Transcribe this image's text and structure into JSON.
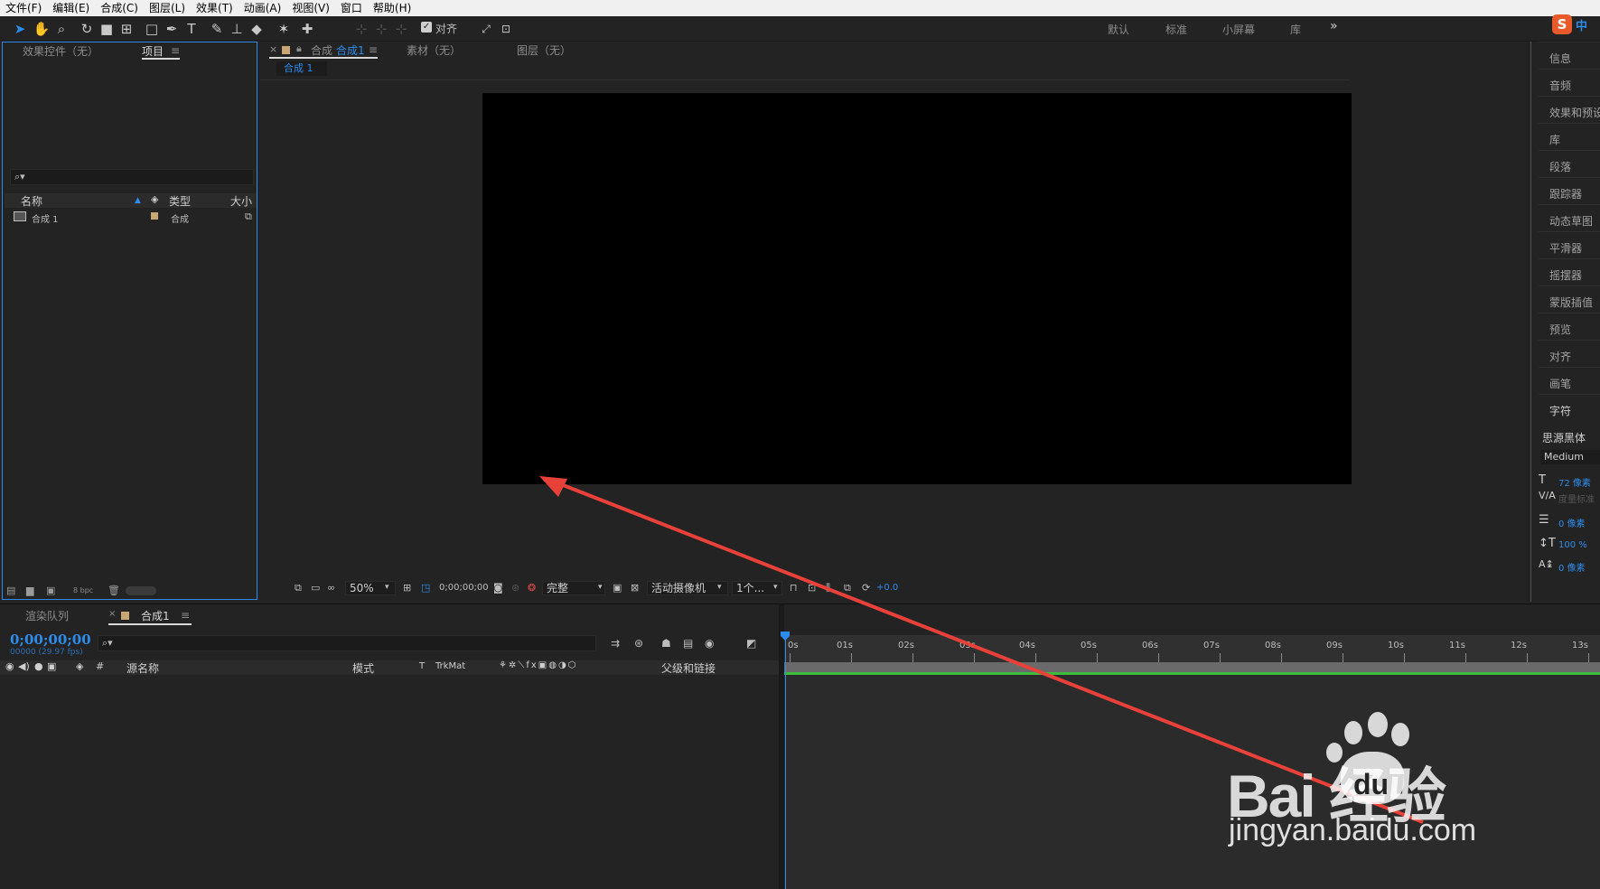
{
  "menubar": [
    "文件(F)",
    "编辑(E)",
    "合成(C)",
    "图层(L)",
    "效果(T)",
    "动画(A)",
    "视图(V)",
    "窗口",
    "帮助(H)"
  ],
  "toolbar": {
    "align_label": "对齐",
    "workspaces": [
      "默认",
      "标准",
      "小屏幕",
      "库"
    ],
    "more": "»"
  },
  "project_panel": {
    "tab_effects": "效果控件（无）",
    "tab_project": "项目",
    "menu_icon": "≡",
    "columns": {
      "name": "名称",
      "type": "类型",
      "size": "大小"
    },
    "items": [
      {
        "name": "合成 1",
        "type": "合成"
      }
    ],
    "bpc": "8 bpc"
  },
  "viewer": {
    "close": "×",
    "tab_comp_prefix": "合成",
    "tab_comp_name": "合成1",
    "tab_footage": "素材（无）",
    "tab_layer": "图层（无）",
    "comp_subtab": "合成 1",
    "zoom": "50%",
    "timecode": "0;00;00;00",
    "resolution": "完整",
    "camera": "活动摄像机",
    "views": "1个...",
    "exposure": "+0.0"
  },
  "right_panel": {
    "items": [
      "信息",
      "音频",
      "效果和预设",
      "库",
      "段落",
      "跟踪器",
      "动态草图",
      "平滑器",
      "摇摆器",
      "蒙版插值",
      "预览",
      "对齐",
      "画笔",
      "字符"
    ],
    "font_name": "思源黑体",
    "font_style": "Medium",
    "font_size": "72 像素",
    "kerning": "度量标准",
    "leading": "0 像素",
    "vscale": "100 %",
    "baseline": "0 像素"
  },
  "timeline": {
    "tab_render": "渲染队列",
    "tab_comp": "合成1",
    "timecode": "0;00;00;00",
    "frames": "00000 (29.97 fps)",
    "columns": {
      "num": "#",
      "source": "源名称",
      "mode": "模式",
      "t": "T",
      "trkmat": "TrkMat",
      "parent": "父级和链接"
    },
    "ruler": [
      "0s",
      "01s",
      "02s",
      "03s",
      "04s",
      "05s",
      "06s",
      "07s",
      "08s",
      "09s",
      "10s",
      "11s",
      "12s",
      "13s"
    ]
  },
  "watermark": {
    "logo": "Bai  经验",
    "du": "du",
    "url": "jingyan.baidu.com"
  },
  "ime": {
    "label": "中"
  },
  "colors": {
    "accent": "#2d8ceb",
    "arrow": "#e8413a",
    "workbar": "#3cbd3c"
  }
}
